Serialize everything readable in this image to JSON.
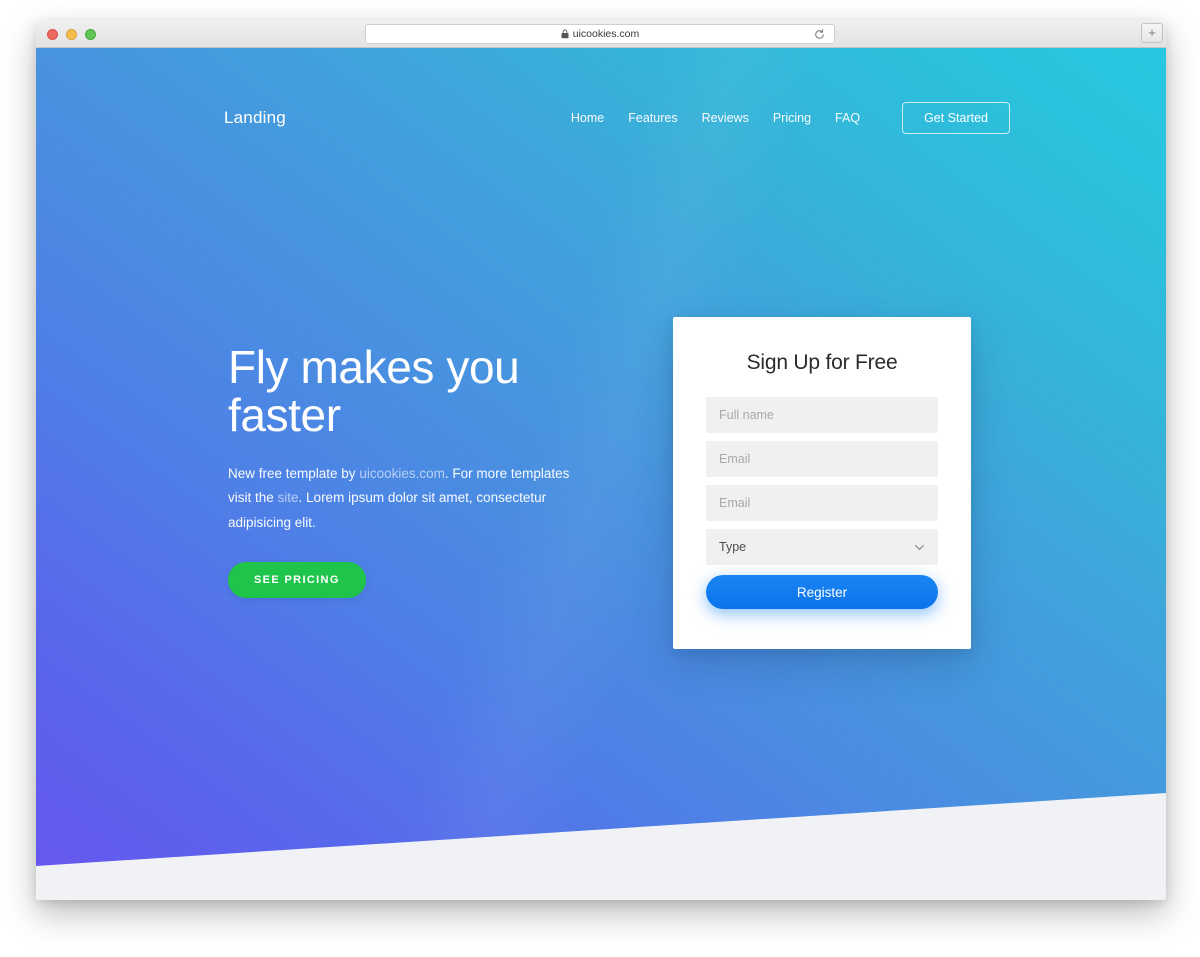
{
  "browser": {
    "url": "uicookies.com",
    "lock_icon": "lock-icon",
    "reload_icon": "reload-icon",
    "new_tab_label": "+",
    "traffic_lights": [
      "close",
      "minimize",
      "zoom"
    ]
  },
  "nav": {
    "brand": "Landing",
    "links": [
      {
        "label": "Home"
      },
      {
        "label": "Features"
      },
      {
        "label": "Reviews"
      },
      {
        "label": "Pricing"
      },
      {
        "label": "FAQ"
      }
    ],
    "cta_label": "Get Started"
  },
  "hero": {
    "title": "Fly makes you faster",
    "paragraph": {
      "part1": "New free template by ",
      "link1": "uicookies.com",
      "part2": ". For more templates visit the ",
      "link2": "site",
      "part3": ". Lorem ipsum dolor sit amet, consectetur adipisicing elit."
    },
    "cta_label": "SEE PRICING"
  },
  "signup": {
    "title": "Sign Up for Free",
    "fields": [
      {
        "name": "full-name",
        "placeholder": "Full name",
        "value": ""
      },
      {
        "name": "email",
        "placeholder": "Email",
        "value": ""
      },
      {
        "name": "email-confirm",
        "placeholder": "Email",
        "value": ""
      }
    ],
    "select": {
      "label": "Type",
      "icon": "chevron-down-icon"
    },
    "submit_label": "Register"
  },
  "colors": {
    "gradient_start": "#6756ef",
    "gradient_mid": "#4697de",
    "gradient_end": "#28c7e1",
    "green_button": "#1fc44a",
    "blue_button": "#1b84f3",
    "bottom_section": "#f0f2f5",
    "card_background": "#ffffff",
    "field_background": "#f0f0f0"
  }
}
